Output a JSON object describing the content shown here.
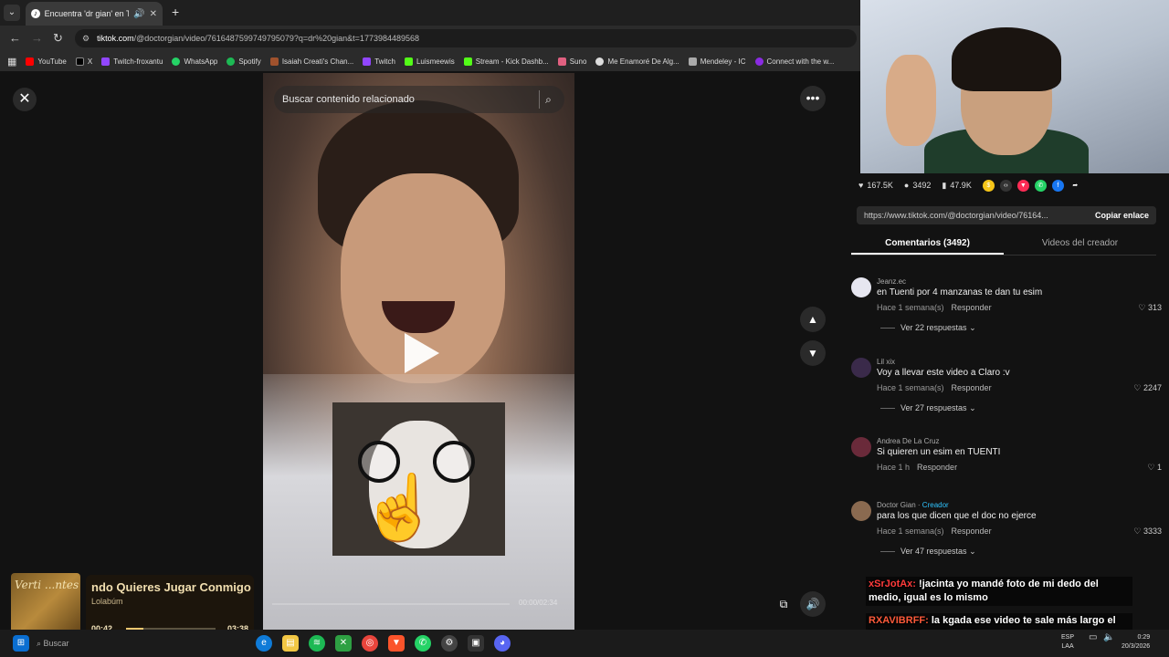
{
  "browser": {
    "tab_title": "Encuentra 'dr gian' en TikTo",
    "url_host": "tiktok.com",
    "url_path": "/@doctorgian/video/7616487599749795079?q=dr%20gian&t=1773984489568",
    "bookmarks": [
      "YouTube",
      "X",
      "Twitch-froxantu",
      "WhatsApp",
      "Spotify",
      "Isaiah Creati's Chan...",
      "Twitch",
      "Luismeewis",
      "Stream - Kick Dashb...",
      "Suno",
      "Me Enamoré De Alg...",
      "Mendeley - IC",
      "Connect with the w..."
    ]
  },
  "search": {
    "placeholder": "Buscar contenido relacionado"
  },
  "stats": {
    "likes": "167.5K",
    "comments": "3492",
    "saves": "47.9K"
  },
  "link": {
    "url": "https://www.tiktok.com/@doctorgian/video/76164...",
    "copy_label": "Copiar enlace"
  },
  "panel_tabs": {
    "comments": "Comentarios (3492)",
    "creator_videos": "Videos del creador"
  },
  "comments": [
    {
      "user": "Jeanz.ec",
      "creator_tag": "",
      "text": "en Tuenti por 4 manzanas te dan tu esim",
      "time": "Hace 1 semana(s)",
      "reply": "Responder",
      "likes": "313",
      "more": "Ver 22 respuestas",
      "avatar_color": "#e6e6f0"
    },
    {
      "user": "Lil xix",
      "creator_tag": "",
      "text": "Voy a llevar este video a Claro :v",
      "time": "Hace 1 semana(s)",
      "reply": "Responder",
      "likes": "2247",
      "more": "Ver 27 respuestas",
      "avatar_color": "#3a2a4a"
    },
    {
      "user": "Andrea De La Cruz",
      "creator_tag": "",
      "text": "Si quieren un esim en TUENTI",
      "time": "Hace 1 h",
      "reply": "Responder",
      "likes": "1",
      "more": "",
      "avatar_color": "#6a2a3a"
    },
    {
      "user": "Doctor Gian · ",
      "creator_tag": "Creador",
      "text": "para los que dicen que el doc no ejerce",
      "time": "Hace 1 semana(s)",
      "reply": "Responder",
      "likes": "3333",
      "more": "Ver 47 respuestas",
      "avatar_color": "#8a6a50"
    }
  ],
  "music": {
    "cover_text": "Verti ...ntes",
    "song": "ndo Quieres Jugar Conmigo",
    "album": "Lolabúm",
    "time_current": "00:42",
    "time_total": "03:38",
    "progress": 0.19
  },
  "chat": [
    {
      "user": "xSrJotAx:",
      "text": " !jacinta yo mandé foto de mi dedo del medio, igual es lo mismo"
    },
    {
      "user": "RXAVIBRFF:",
      "text": " la kgada ese video te sale más largo el juicio que la webada de cancelarlo"
    }
  ],
  "video": {
    "time_overlay": "00:00/02:34"
  },
  "taskbar": {
    "search_label": "Buscar",
    "lang": "ESP",
    "lang_sub": "LAA",
    "time": "0:29",
    "date": "20/3/2026"
  }
}
